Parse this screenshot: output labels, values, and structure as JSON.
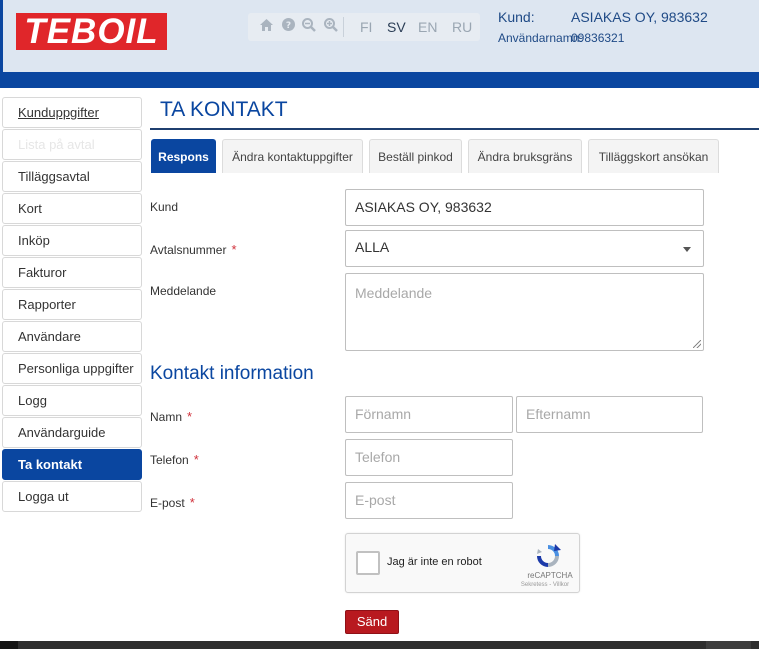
{
  "brand": {
    "logo_text": "TEBOIL",
    "color": "#e0262a"
  },
  "toolbar": {
    "icons": [
      "home-icon",
      "help-icon",
      "zoom-out-icon",
      "zoom-in-icon"
    ],
    "languages": [
      "FI",
      "SV",
      "EN",
      "RU"
    ],
    "active_language": "SV"
  },
  "account": {
    "kund_label": "Kund:",
    "kund_value": "ASIAKAS OY, 983632",
    "user_label": "Användarnamn:",
    "user_value": "09836321"
  },
  "sidebar": {
    "items": [
      {
        "label": "Kunduppgifter"
      },
      {
        "label": "Lista på avtal"
      },
      {
        "label": "Tilläggsavtal"
      },
      {
        "label": "Kort"
      },
      {
        "label": "Inköp"
      },
      {
        "label": "Fakturor"
      },
      {
        "label": "Rapporter"
      },
      {
        "label": "Användare"
      },
      {
        "label": "Personliga uppgifter"
      },
      {
        "label": "Logg"
      },
      {
        "label": "Användarguide"
      },
      {
        "label": "Ta kontakt"
      },
      {
        "label": "Logga ut"
      }
    ],
    "active": "Ta kontakt"
  },
  "page": {
    "title": "TA KONTAKT"
  },
  "tabs": [
    {
      "label": "Respons"
    },
    {
      "label": "Ändra kontaktuppgifter"
    },
    {
      "label": "Beställ pinkod"
    },
    {
      "label": "Ändra bruksgräns"
    },
    {
      "label": "Tilläggskort ansökan"
    }
  ],
  "form": {
    "kund_label": "Kund",
    "kund_value": "ASIAKAS OY, 983632",
    "avtal_label": "Avtalsnummer",
    "avtal_value": "ALLA",
    "meddelande_label": "Meddelande",
    "meddelande_placeholder": "Meddelande",
    "required_mark": "*"
  },
  "contact": {
    "section_title": "Kontakt information",
    "namn_label": "Namn",
    "fornamn_placeholder": "Förnamn",
    "efternamn_placeholder": "Efternamn",
    "telefon_label": "Telefon",
    "telefon_placeholder": "Telefon",
    "epost_label": "E-post",
    "epost_placeholder": "E-post"
  },
  "captcha": {
    "text": "Jag är inte en robot",
    "brand": "reCAPTCHA",
    "links": "Sekretess - Villkor"
  },
  "submit": {
    "label": "Sänd"
  },
  "colors": {
    "primary": "#0a46a0",
    "header_bg": "#dde6f1",
    "send": "#b8191f"
  }
}
